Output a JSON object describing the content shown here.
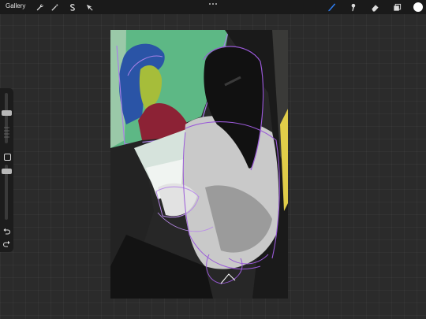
{
  "topbar": {
    "gallery_label": "Gallery",
    "left_tools": [
      "wrench-icon",
      "magic-wand-icon",
      "selection-s-icon",
      "transform-arrow-icon"
    ],
    "right_tools": [
      "brush-icon",
      "smudge-icon",
      "eraser-icon",
      "layers-icon"
    ],
    "current_color": "#ffffff",
    "active_tool_color": "#2f7ff5"
  },
  "sidebar": {
    "brush_size_level": 0.15,
    "opacity_level": 0.8,
    "buttons": [
      "modify-square-button",
      "undo-icon",
      "redo-icon"
    ]
  },
  "artwork": {
    "description_colors": [
      "#5db885",
      "#2a54a6",
      "#a6bd3a",
      "#8c2235",
      "#9a5ad8",
      "#111111",
      "#c9c9c9"
    ]
  }
}
